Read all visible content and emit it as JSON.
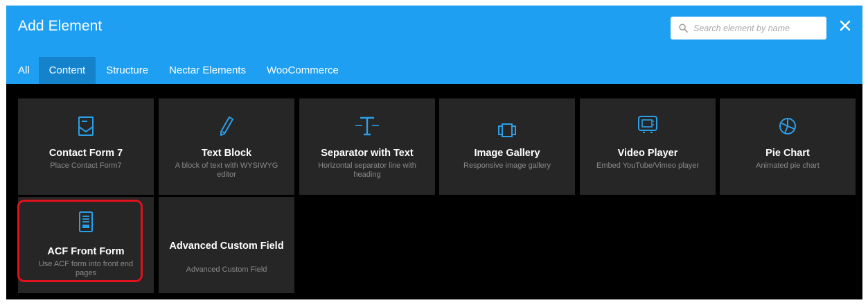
{
  "dialog": {
    "title": "Add Element",
    "search_placeholder": "Search element by name",
    "accent_color": "#1e9ff2",
    "active_tab_color": "#1483cc",
    "highlight_color": "#e0101c"
  },
  "tabs": [
    {
      "label": "All",
      "active": false
    },
    {
      "label": "Content",
      "active": true
    },
    {
      "label": "Structure",
      "active": false
    },
    {
      "label": "Nectar Elements",
      "active": false
    },
    {
      "label": "WooCommerce",
      "active": false
    }
  ],
  "elements": [
    {
      "name": "Contact Form 7",
      "desc": "Place Contact Form7",
      "icon": "envelope-form-icon"
    },
    {
      "name": "Text Block",
      "desc": "A block of text with WYSIWYG editor",
      "icon": "pencil-icon"
    },
    {
      "name": "Separator with Text",
      "desc": "Horizontal separator line with heading",
      "icon": "text-separator-icon"
    },
    {
      "name": "Image Gallery",
      "desc": "Responsive image gallery",
      "icon": "gallery-icon"
    },
    {
      "name": "Video Player",
      "desc": "Embed YouTube/Vimeo player",
      "icon": "monitor-icon"
    },
    {
      "name": "Pie Chart",
      "desc": "Animated pie chart",
      "icon": "pie-chart-icon"
    },
    {
      "name": "ACF Front Form",
      "desc": "Use ACF form into front end pages",
      "icon": "document-form-icon",
      "highlighted": true
    },
    {
      "name": "Advanced Custom Field",
      "desc": "Advanced Custom Field",
      "icon": ""
    }
  ]
}
